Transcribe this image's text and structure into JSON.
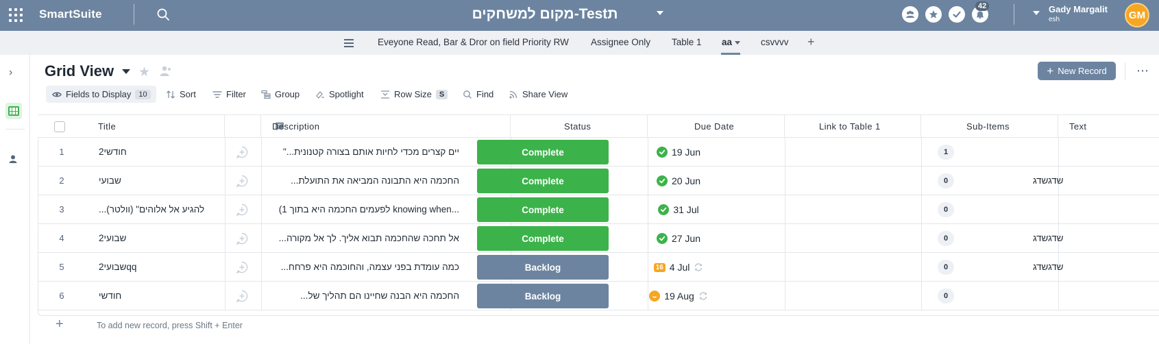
{
  "topbar": {
    "brand": "SmartSuite",
    "workspace_name": "מקום למשחקים-Testת",
    "notifications_count": "42",
    "user_name": "Gady Margalit",
    "user_sub": "esh",
    "avatar_initials": "GM"
  },
  "tabs": {
    "items": [
      {
        "label": "Eveyone Read, Bar & Dror on field Priority RW"
      },
      {
        "label": "Assignee Only"
      },
      {
        "label": "Table 1"
      },
      {
        "label": "aa"
      },
      {
        "label": "csvvvv"
      }
    ],
    "active_index": 3,
    "add_label": "+"
  },
  "view": {
    "title": "Grid View",
    "new_record_label": "New Record"
  },
  "toolbar": {
    "fields_label": "Fields to Display",
    "fields_count": "10",
    "sort_label": "Sort",
    "filter_label": "Filter",
    "group_label": "Group",
    "spotlight_label": "Spotlight",
    "row_size_label": "Row Size",
    "row_size_value": "S",
    "find_label": "Find",
    "share_label": "Share View"
  },
  "grid": {
    "columns": {
      "title": "Title",
      "description": "Description",
      "status": "Status",
      "due_date": "Due Date",
      "link": "Link to Table 1",
      "sub_items": "Sub-Items",
      "text": "Text"
    },
    "rows": [
      {
        "num": "1",
        "title": "חודשי2",
        "description": "\"...יים קצרים מכדי לחיות אותם בצורה קטנונית",
        "status": "Complete",
        "due": "19 Jun",
        "due_state": "ok",
        "due_badge": "",
        "sub_items": "1",
        "text": ""
      },
      {
        "num": "2",
        "title": "שבועי",
        "description": "...החכמה היא התבונה המביאה את התועלת",
        "status": "Complete",
        "due": "20 Jun",
        "due_state": "ok",
        "due_badge": "",
        "sub_items": "0",
        "text": "שדגשדג"
      },
      {
        "num": "3",
        "title": "...להגיע אל אלוהים\" (וולטר)",
        "description": "(1 לפעמים החכמה היא בתוך knowing when...",
        "status": "Complete",
        "due": "31 Jul",
        "due_state": "ok",
        "due_badge": "",
        "sub_items": "0",
        "text": ""
      },
      {
        "num": "4",
        "title": "שבועי2",
        "description": "...אל תחכה שהחכמה תבוא אליך. לך אל מקורה",
        "status": "Complete",
        "due": "27 Jun",
        "due_state": "ok",
        "due_badge": "",
        "sub_items": "0",
        "text": "שדגשדג"
      },
      {
        "num": "5",
        "title": "שבועי2qq",
        "description": "...כמה עומדת בפני עצמה, והחוכמה היא פרחח",
        "status": "Backlog",
        "due": "4 Jul",
        "due_state": "late",
        "due_badge": "16",
        "sub_items": "0",
        "text": "שדגשדג"
      },
      {
        "num": "6",
        "title": "חודשי",
        "description": "...החכמה היא הבנה שחיינו הם תהליך של",
        "status": "Backlog",
        "due": "19 Aug",
        "due_state": "upcoming",
        "due_badge": "",
        "sub_items": "0",
        "text": ""
      }
    ],
    "add_hint": "To add new record, press Shift + Enter"
  },
  "colors": {
    "topbar": "#6c84a0",
    "complete": "#3cb34a",
    "backlog": "#6c84a0",
    "avatar": "#f5a623"
  }
}
